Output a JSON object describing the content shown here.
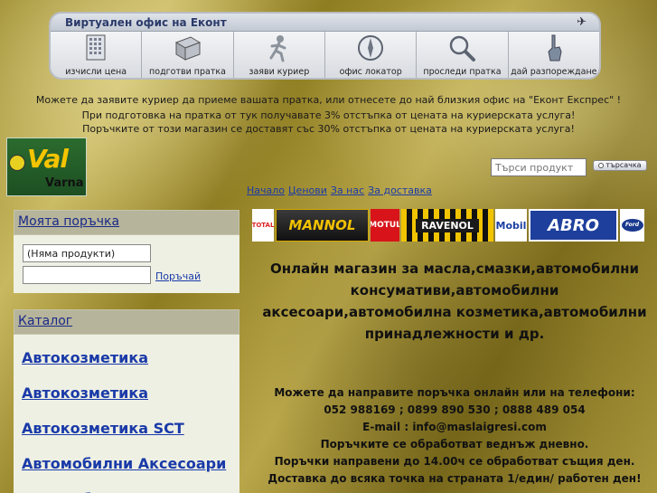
{
  "econt": {
    "title": "Виртуален офис на Еконт",
    "items": [
      {
        "label": "изчисли цена",
        "icon": "calculator-icon"
      },
      {
        "label": "подготви пратка",
        "icon": "package-icon"
      },
      {
        "label": "заяви куриер",
        "icon": "courier-icon"
      },
      {
        "label": "офис локатор",
        "icon": "compass-icon"
      },
      {
        "label": "проследи пратка",
        "icon": "magnifier-icon"
      },
      {
        "label": "дай разпореждане",
        "icon": "pointing-hand-icon"
      }
    ]
  },
  "notice": {
    "line1": "Можете да заявите куриер да приеме вашата пратка, или отнесете до най близкия офис на \"Еконт Експрес\" !",
    "line2": "При подготовка на пратка от тук получавате 3% отстъпка от цената на куриерската услуга!",
    "line3": "Поръчките от този магазин се доставят със 30% отстъпка от цената на куриерската услуга!"
  },
  "logo": {
    "text": "Val",
    "sub": "Varna"
  },
  "search": {
    "placeholder": "Търси продукт",
    "button": "търсачка"
  },
  "topnav": [
    "Начало",
    "Ценови",
    "За нас",
    "За доставка"
  ],
  "cart": {
    "title": "Моята поръчка",
    "items_value": "(Няма продукти)",
    "order_link": "Поръчай"
  },
  "catalog": {
    "title": "Каталог",
    "items": [
      "Автокозметика",
      "Автокозметика",
      "Автокозметика SCT",
      "Автомобилни Аксесоари",
      "Автомобилни антени"
    ]
  },
  "brands": [
    "TOTAL",
    "MANNOL",
    "MOTUL",
    "RAVENOL",
    "Mobil",
    "ABRO",
    "Ford"
  ],
  "headline": {
    "line1": "Онлайн магазин за масла,смазки,автомобилни",
    "line2": "консумативи,автомобилни",
    "line3": "аксесоари,автомобилна козметика,автомобилни",
    "line4": "принадлежности и др."
  },
  "contact": {
    "line1": "Можете да направите поръчка онлайн или на телефони:",
    "line2": "052 988169 ; 0899 890 530 ; 0888 489 054",
    "line3": "E-mail : info@maslaigresi.com",
    "line4": "Поръчките се обработват веднъж дневно.",
    "line5": "Поръчки направени до 14.00ч се обработват същия ден.",
    "line6": "Доставка до всяка точка на страната 1/един/ работен ден!"
  },
  "colors": {
    "link": "#1a3aa8",
    "panel_head": "#b6b49a",
    "logo_green": "#2b6b2e",
    "logo_yellow": "#f5c400"
  }
}
